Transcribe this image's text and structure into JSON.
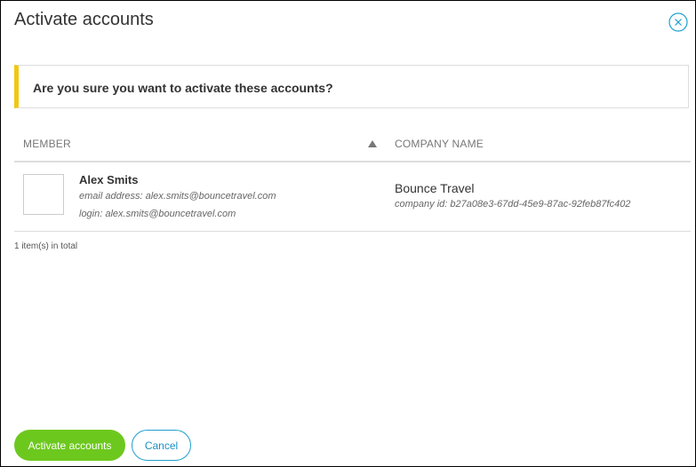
{
  "dialog": {
    "title": "Activate accounts",
    "close_icon": "close-icon",
    "colors": {
      "accent_green": "#6dc81e",
      "accent_blue": "#1fa0d0",
      "alert_yellow": "#f2c811"
    }
  },
  "alert": {
    "message": "Are you sure you want to activate these accounts?"
  },
  "table": {
    "columns": {
      "member": "MEMBER",
      "company": "COMPANY NAME"
    },
    "sort_icon": "sort-ascending-icon",
    "rows": [
      {
        "name": "Alex Smits",
        "email": "email address: alex.smits@bouncetravel.com",
        "login": "login: alex.smits@bouncetravel.com",
        "company_name": "Bounce Travel",
        "company_id": "company id: b27a08e3-67dd-45e9-87ac-92feb87fc402"
      }
    ],
    "total": "1 item(s) in total"
  },
  "footer": {
    "activate_label": "Activate accounts",
    "cancel_label": "Cancel"
  }
}
